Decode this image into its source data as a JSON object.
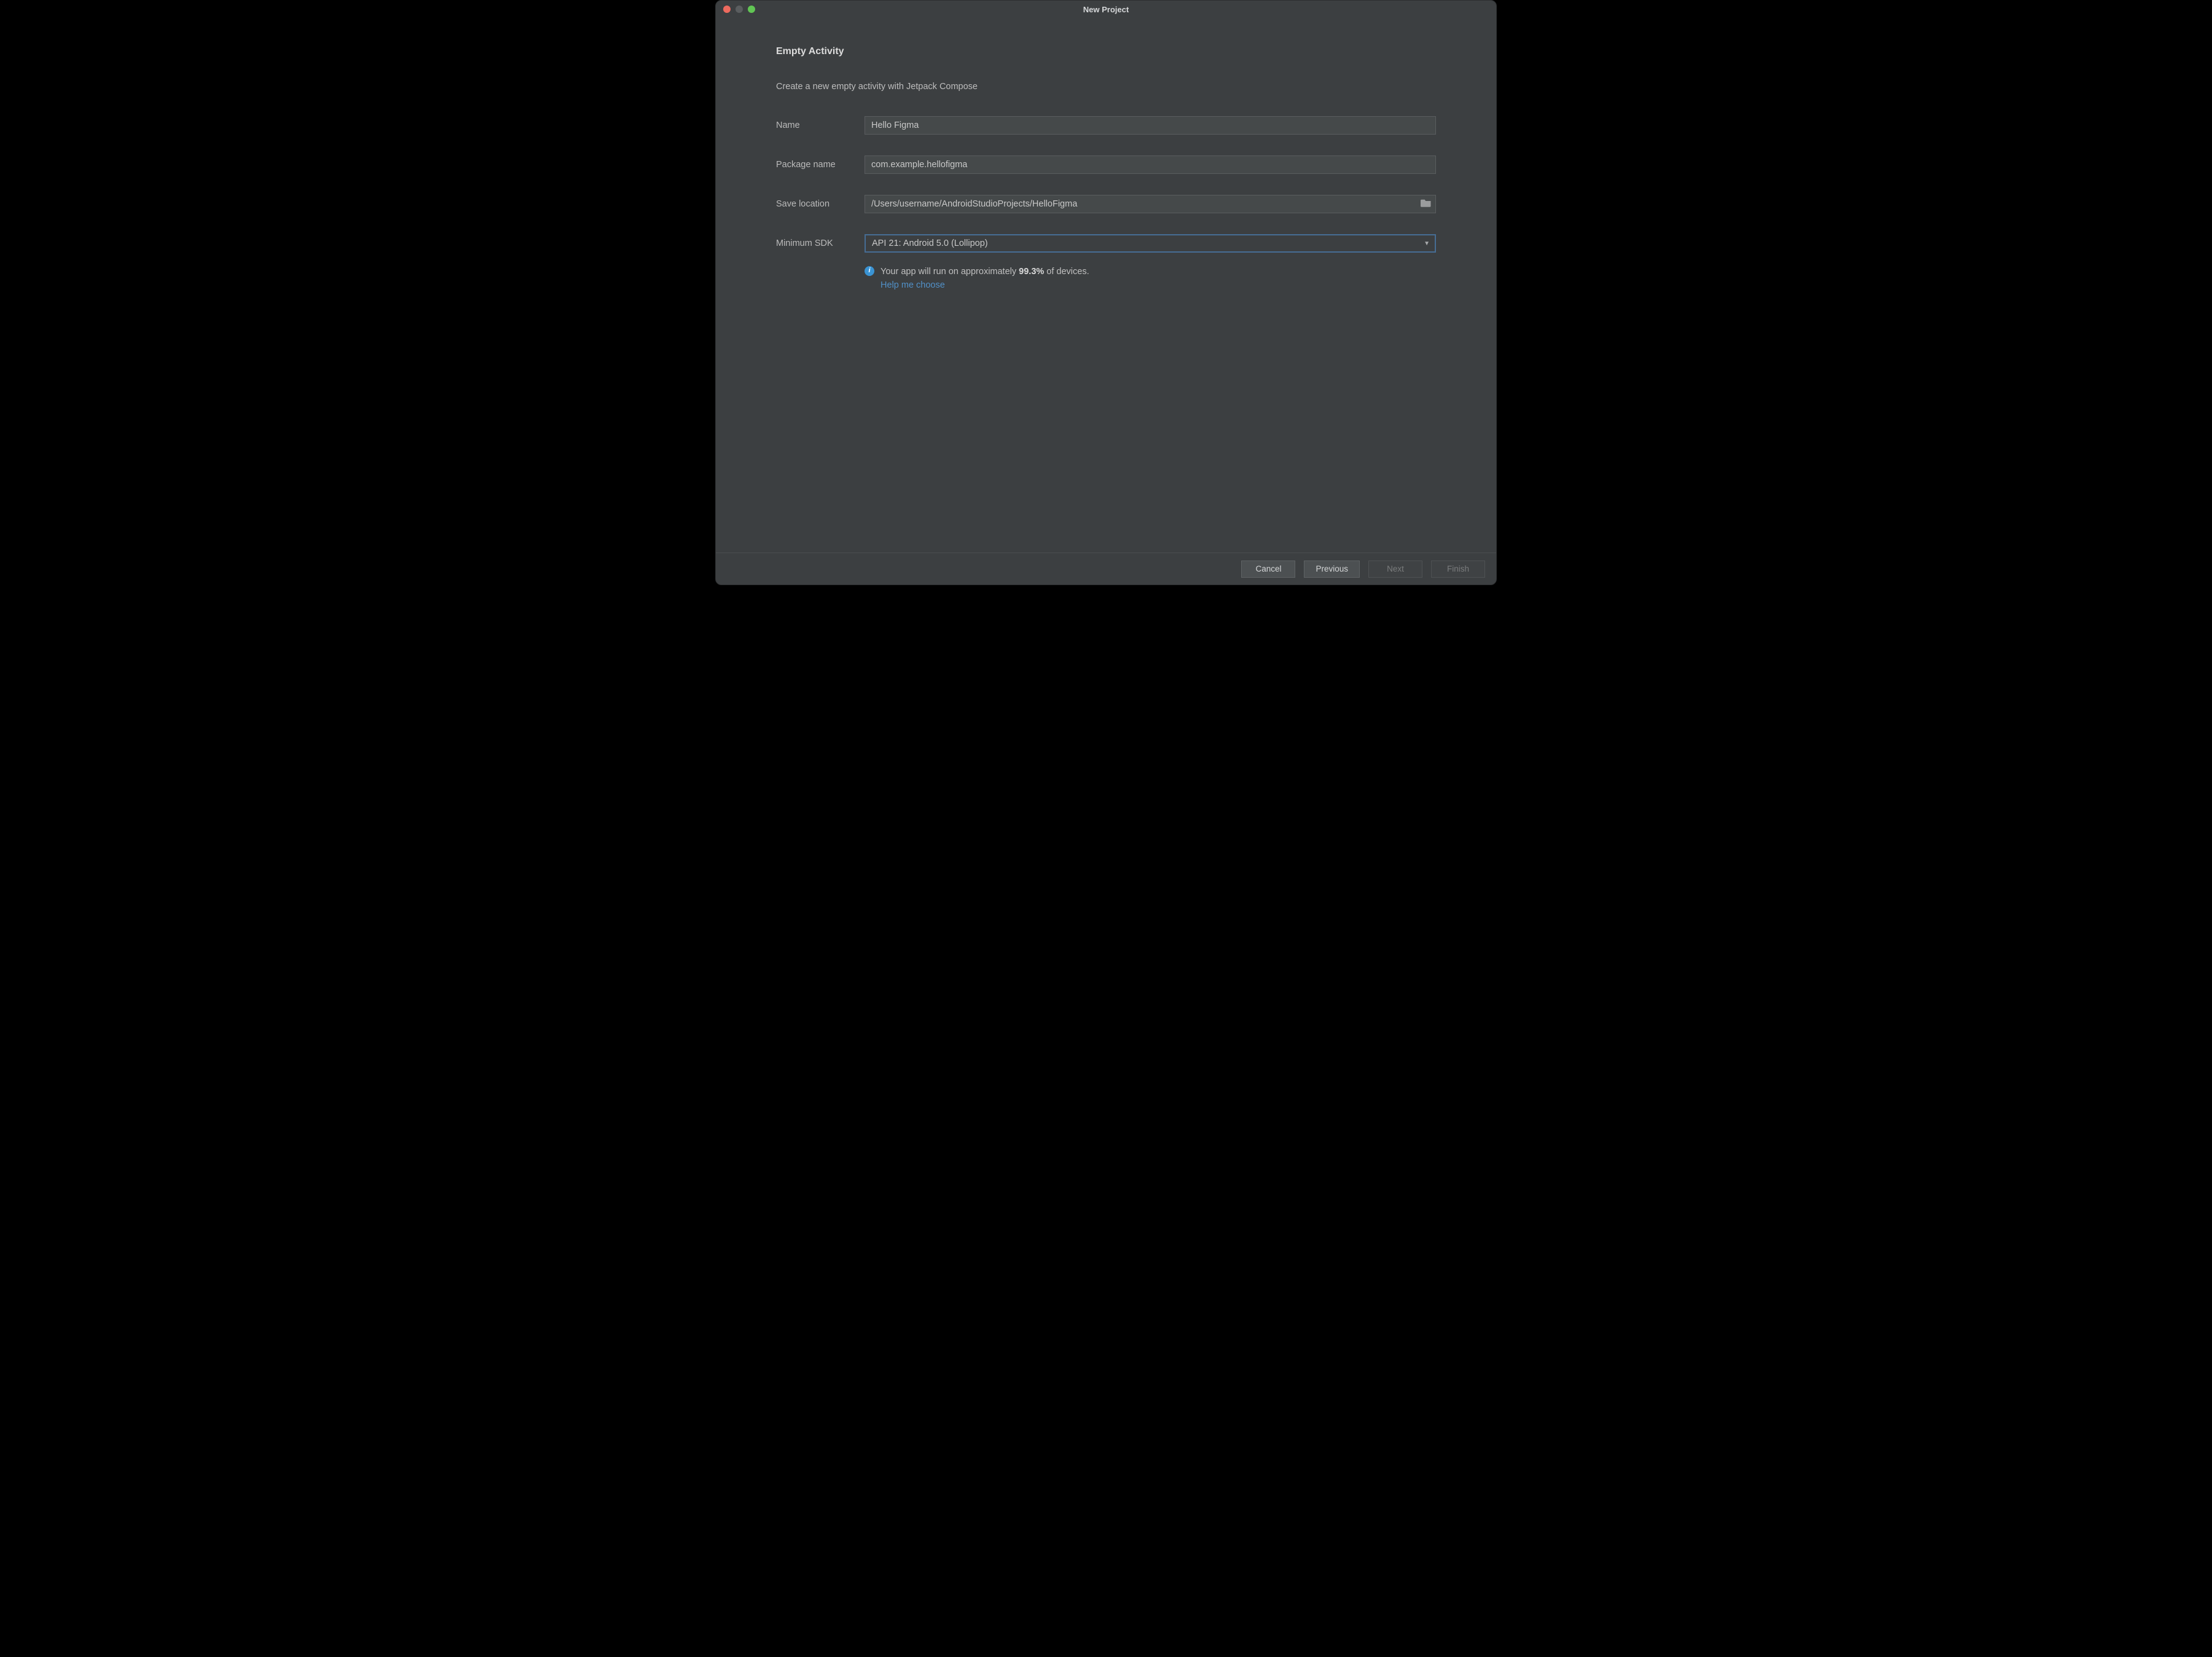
{
  "window": {
    "title": "New Project"
  },
  "page": {
    "heading": "Empty Activity",
    "subheading": "Create a new empty activity with Jetpack Compose"
  },
  "fields": {
    "name": {
      "label": "Name",
      "value": "Hello Figma"
    },
    "package": {
      "label": "Package name",
      "value": "com.example.hellofigma"
    },
    "location": {
      "label": "Save location",
      "value": "/Users/username/AndroidStudioProjects/HelloFigma"
    },
    "minSdk": {
      "label": "Minimum SDK",
      "value": "API 21: Android 5.0 (Lollipop)"
    }
  },
  "info": {
    "prefix": "Your app will run on approximately ",
    "percent": "99.3%",
    "suffix": " of devices.",
    "help": "Help me choose"
  },
  "buttons": {
    "cancel": "Cancel",
    "previous": "Previous",
    "next": "Next",
    "finish": "Finish"
  }
}
